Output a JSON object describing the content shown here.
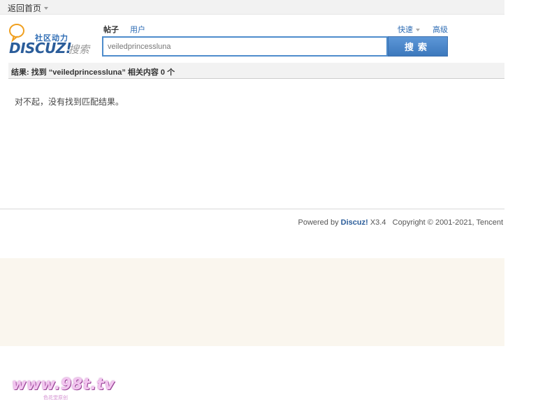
{
  "topbar": {
    "home_label": "返回首页"
  },
  "logo": {
    "tagline": "社区动力",
    "brand": "DISCUZ!",
    "brand_suffix": "搜索"
  },
  "search": {
    "tabs": [
      {
        "label": "帖子",
        "active": true
      },
      {
        "label": "用户",
        "active": false
      }
    ],
    "quick_label": "快速",
    "advanced_label": "高级",
    "query": "veiledprincessluna",
    "button_label": "搜索"
  },
  "result": {
    "summary": "结果: 找到 “veiledprincessluna” 相关内容 0 个",
    "empty_message": "对不起，没有找到匹配结果。"
  },
  "footer": {
    "powered_by": "Powered by",
    "brand": "Discuz!",
    "version": "X3.4",
    "copyright": "Copyright © 2001-2021, Tencent"
  },
  "watermark": {
    "text": "www.98t.tv",
    "subtext": "色花堂原创"
  },
  "colors": {
    "accent": "#2e6cb4",
    "search_border": "#4e8ccc",
    "button": "#4a86c8",
    "bar_bg": "#f2f2f2",
    "beige": "#faf6ee"
  }
}
